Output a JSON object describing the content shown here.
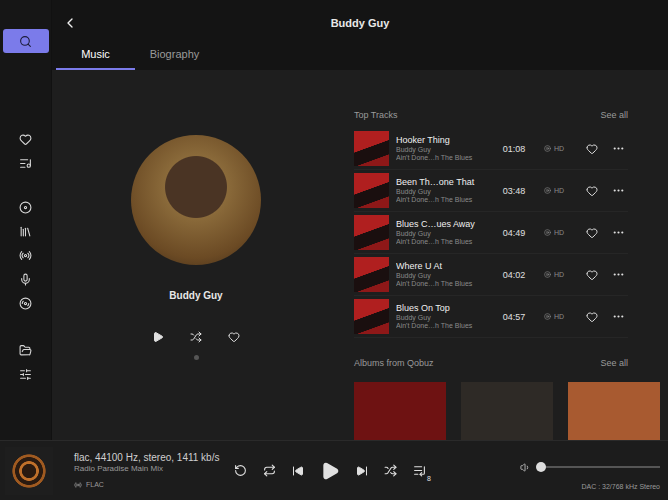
{
  "header": {
    "title": "Buddy Guy"
  },
  "tabs": [
    {
      "label": "Music",
      "selected": true
    },
    {
      "label": "Biography",
      "selected": false
    }
  ],
  "sidebar": {
    "groups": [
      {
        "items": [
          {
            "selected": true
          }
        ]
      },
      {
        "items": [
          {
            "selected": false
          },
          {
            "selected": false
          }
        ]
      },
      {
        "items": [
          {
            "selected": false
          },
          {
            "selected": false
          },
          {
            "selected": false
          },
          {
            "selected": false
          },
          {
            "selected": false
          }
        ]
      },
      {
        "items": [
          {
            "selected": false
          },
          {
            "selected": false
          }
        ]
      }
    ]
  },
  "artist": {
    "name": "Buddy Guy",
    "favorite": false
  },
  "top_tracks": {
    "title": "Top Tracks",
    "see_all": "See all",
    "tracks": [
      {
        "title": "Hooker Thing",
        "artist": "Buddy Guy",
        "album": "Ain't Done…h The Blues",
        "duration": "01:08",
        "quality": "HD",
        "favorite": false
      },
      {
        "title": "Been Th…one That",
        "artist": "Buddy Guy",
        "album": "Ain't Done…h The Blues",
        "duration": "03:48",
        "quality": "HD",
        "favorite": false
      },
      {
        "title": "Blues C…ues Away",
        "artist": "Buddy Guy",
        "album": "Ain't Done…h The Blues",
        "duration": "04:49",
        "quality": "HD",
        "favorite": false
      },
      {
        "title": "Where U At",
        "artist": "Buddy Guy",
        "album": "Ain't Done…h The Blues",
        "duration": "04:02",
        "quality": "HD",
        "favorite": false
      },
      {
        "title": "Blues On Top",
        "artist": "Buddy Guy",
        "album": "Ain't Done…h The Blues",
        "duration": "04:57",
        "quality": "HD",
        "favorite": false
      }
    ]
  },
  "albums": {
    "title": "Albums from Qobuz",
    "see_all": "See all",
    "items": [
      {
        "color": "#6e1212"
      },
      {
        "color": "#2e2a26"
      },
      {
        "color": "#a85a30"
      }
    ]
  },
  "player": {
    "format": "flac, 44100 Hz, stereo, 1411 kb/s",
    "station": "Radio Paradise Main Mix",
    "badge": "FLAC",
    "queue_count": "8",
    "dac": "DAC : 32/768 kHz Stereo",
    "volume": {
      "level": 0.02
    }
  }
}
